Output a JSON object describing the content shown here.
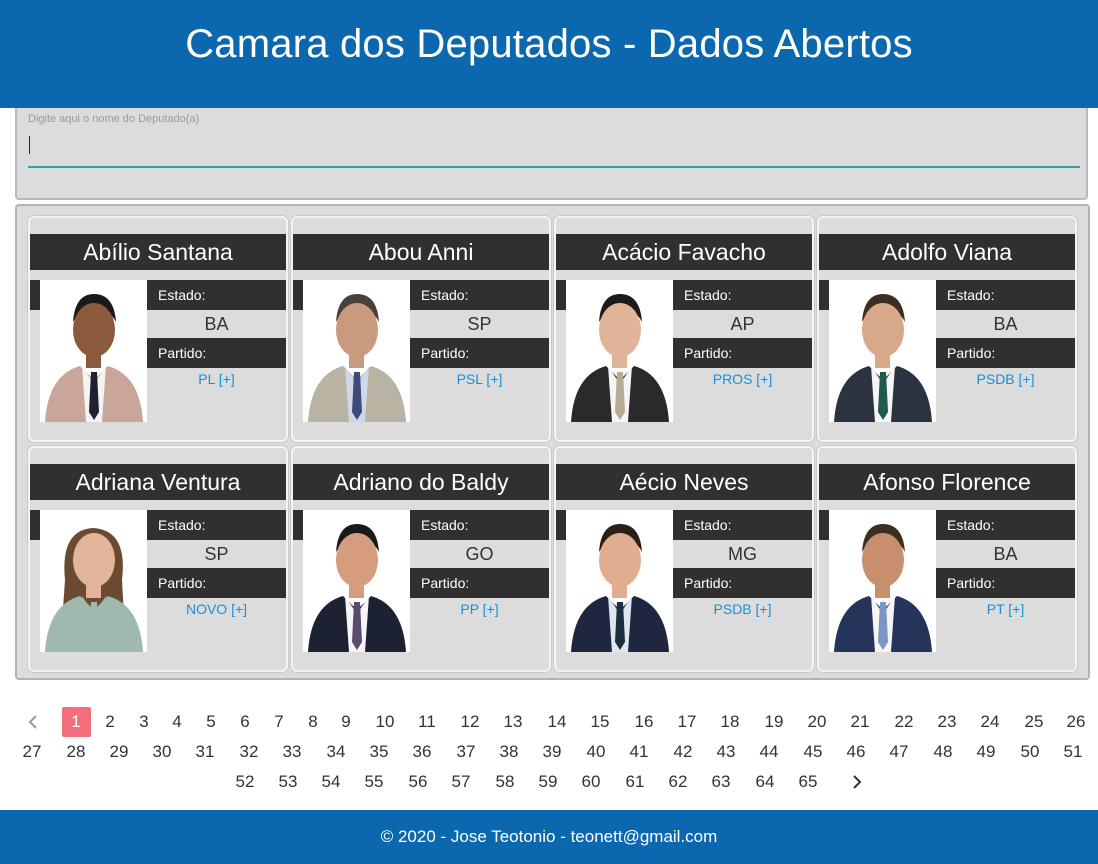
{
  "header": {
    "title": "Camara dos Deputados - Dados Abertos"
  },
  "search": {
    "label": "Digite aqui o nome do Deputado(a)",
    "value": "",
    "placeholder": ""
  },
  "card_labels": {
    "estado": "Estado:",
    "partido": "Partido:"
  },
  "deputies": [
    {
      "name": "Abílio Santana",
      "estado": "BA",
      "partido": "PL [+]"
    },
    {
      "name": "Abou Anni",
      "estado": "SP",
      "partido": "PSL [+]"
    },
    {
      "name": "Acácio Favacho",
      "estado": "AP",
      "partido": "PROS [+]"
    },
    {
      "name": "Adolfo Viana",
      "estado": "BA",
      "partido": "PSDB [+]"
    },
    {
      "name": "Adriana Ventura",
      "estado": "SP",
      "partido": "NOVO [+]"
    },
    {
      "name": "Adriano do Baldy",
      "estado": "GO",
      "partido": "PP [+]"
    },
    {
      "name": "Aécio Neves",
      "estado": "MG",
      "partido": "PSDB [+]"
    },
    {
      "name": "Afonso Florence",
      "estado": "BA",
      "partido": "PT [+]"
    }
  ],
  "pagination": {
    "prev_icon": "chevron-left-icon",
    "next_icon": "chevron-right-icon",
    "current": 1,
    "pages": [
      "1",
      "2",
      "3",
      "4",
      "5",
      "6",
      "7",
      "8",
      "9",
      "10",
      "11",
      "12",
      "13",
      "14",
      "15",
      "16",
      "17",
      "18",
      "19",
      "20",
      "21",
      "22",
      "23",
      "24",
      "25",
      "26",
      "27",
      "28",
      "29",
      "30",
      "31",
      "32",
      "33",
      "34",
      "35",
      "36",
      "37",
      "38",
      "39",
      "40",
      "41",
      "42",
      "43",
      "44",
      "45",
      "46",
      "47",
      "48",
      "49",
      "50",
      "51",
      "52",
      "53",
      "54",
      "55",
      "56",
      "57",
      "58",
      "59",
      "60",
      "61",
      "62",
      "63",
      "64",
      "65"
    ]
  },
  "footer": {
    "text": "© 2020 - Jose Teotonio - teonett@gmail.com"
  },
  "colors": {
    "brand": "#0b67ae",
    "active_page": "#f26f7b",
    "link": "#1a8fd8",
    "input_underline": "#2ba6a6"
  }
}
